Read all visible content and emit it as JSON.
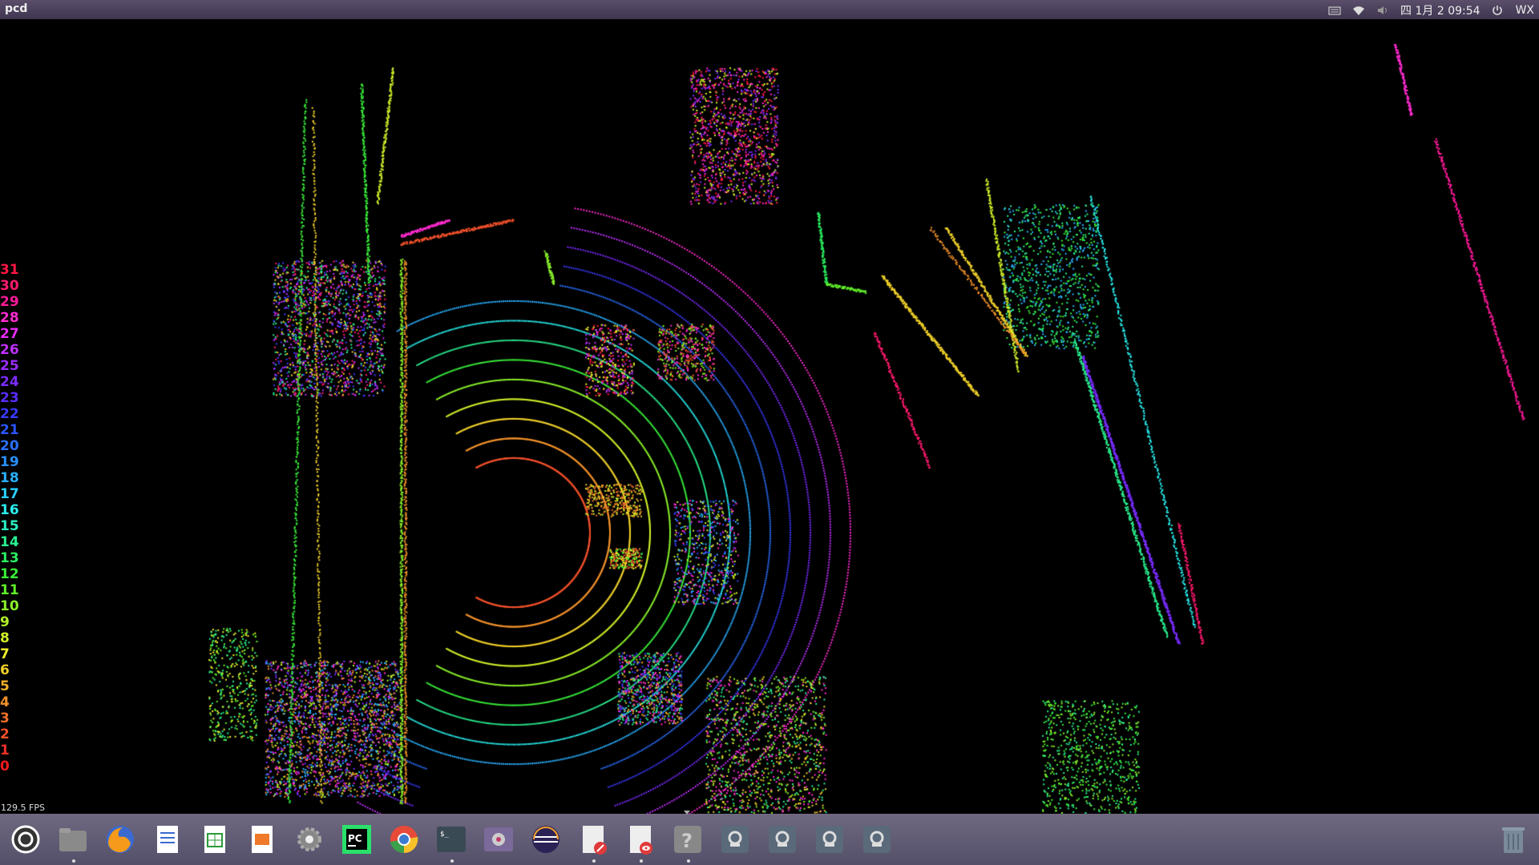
{
  "window": {
    "title": "pcd"
  },
  "tray": {
    "keyboard_icon": "keyboard-icon",
    "wifi_icon": "wifi-icon",
    "volume_icon": "volume-icon",
    "datetime": "四 1月 2 09:54",
    "power_icon": "power-icon",
    "user": "WX"
  },
  "legend": {
    "items": [
      "31",
      "30",
      "29",
      "28",
      "27",
      "26",
      "25",
      "24",
      "23",
      "22",
      "21",
      "20",
      "19",
      "18",
      "17",
      "16",
      "15",
      "14",
      "13",
      "12",
      "11",
      "10",
      "9",
      "8",
      "7",
      "6",
      "5",
      "4",
      "3",
      "2",
      "1",
      "0"
    ],
    "colors": [
      "#ff1744",
      "#ff1a6e",
      "#ff1a9a",
      "#ff2bd0",
      "#e62cf5",
      "#c030ff",
      "#9a2cff",
      "#7a2cff",
      "#5a2cff",
      "#3a3aff",
      "#2a56ff",
      "#2a70ff",
      "#2a90ff",
      "#2ab0ff",
      "#2ad0ff",
      "#2af0f0",
      "#2af0c0",
      "#2af090",
      "#2af060",
      "#3af03a",
      "#60f02a",
      "#8af02a",
      "#b0f02a",
      "#d0f02a",
      "#f0f02a",
      "#f0d02a",
      "#f0b02a",
      "#f0902a",
      "#f0702a",
      "#f0502a",
      "#f0302a",
      "#f01a1a"
    ]
  },
  "fps": "129.5 FPS",
  "dock": {
    "items": [
      {
        "name": "ubuntu-launcher-icon"
      },
      {
        "name": "files-icon"
      },
      {
        "name": "firefox-icon"
      },
      {
        "name": "writer-icon"
      },
      {
        "name": "calc-icon"
      },
      {
        "name": "impress-icon"
      },
      {
        "name": "settings-icon"
      },
      {
        "name": "pycharm-icon"
      },
      {
        "name": "chrome-icon"
      },
      {
        "name": "terminal-icon"
      },
      {
        "name": "video-icon"
      },
      {
        "name": "eclipse-icon"
      },
      {
        "name": "text-editor-icon"
      },
      {
        "name": "viewer-icon"
      },
      {
        "name": "help-icon"
      },
      {
        "name": "app-window-icon"
      },
      {
        "name": "app-window-icon"
      },
      {
        "name": "app-window-icon"
      },
      {
        "name": "app-window-icon"
      },
      {
        "name": "trash-icon"
      }
    ]
  }
}
